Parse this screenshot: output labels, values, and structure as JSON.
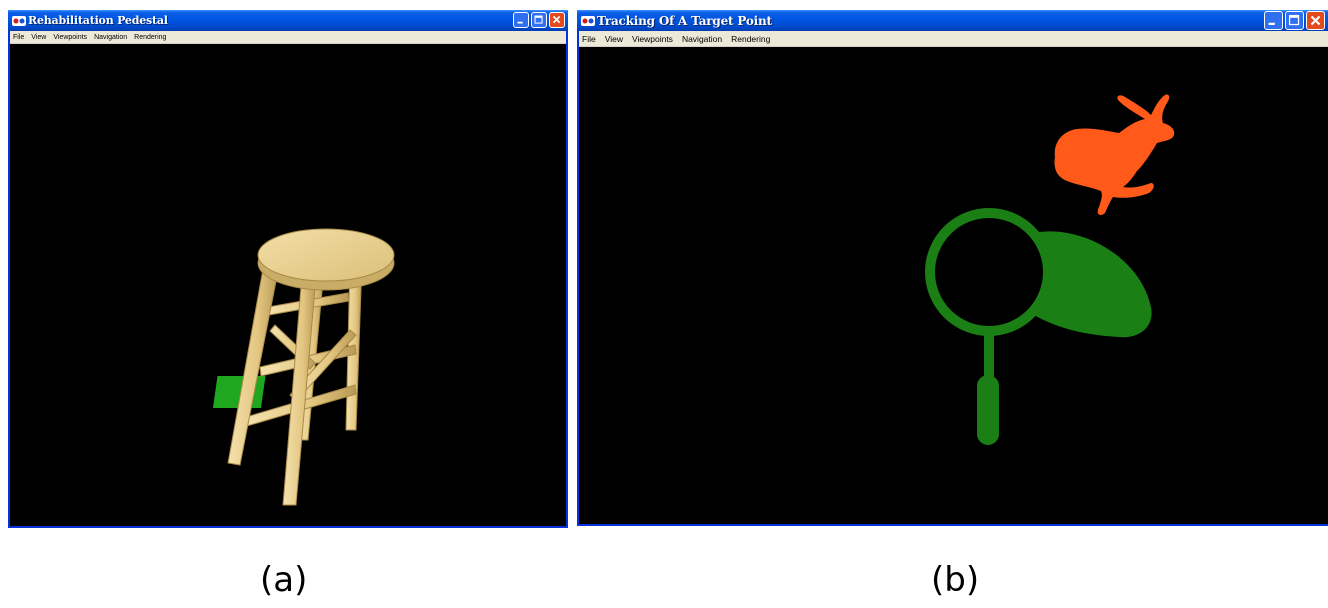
{
  "panels": [
    {
      "title": "Rehabilitation Pedestal",
      "menu": [
        "File",
        "View",
        "Viewpoints",
        "Navigation",
        "Rendering"
      ],
      "scene": [
        "stool",
        "green target marker"
      ],
      "caption": "(a)"
    },
    {
      "title": "Tracking Of A Target Point",
      "menu": [
        "File",
        "View",
        "Viewpoints",
        "Navigation",
        "Rendering"
      ],
      "scene": [
        "rabbit",
        "butterfly net"
      ],
      "caption": "(b)"
    }
  ],
  "colors": {
    "titlebar": "#0054e3",
    "window_border": "#0831d9",
    "menubar": "#ece9d8",
    "viewport": "#000000",
    "stool": "#e8cf8f",
    "target_green": "#1fa81f",
    "rabbit": "#ff5a1a",
    "net": "#1a7f14",
    "close_button": "#e34a1e"
  },
  "icons": [
    "app-icon",
    "minimize-icon",
    "maximize-icon",
    "close-icon"
  ]
}
